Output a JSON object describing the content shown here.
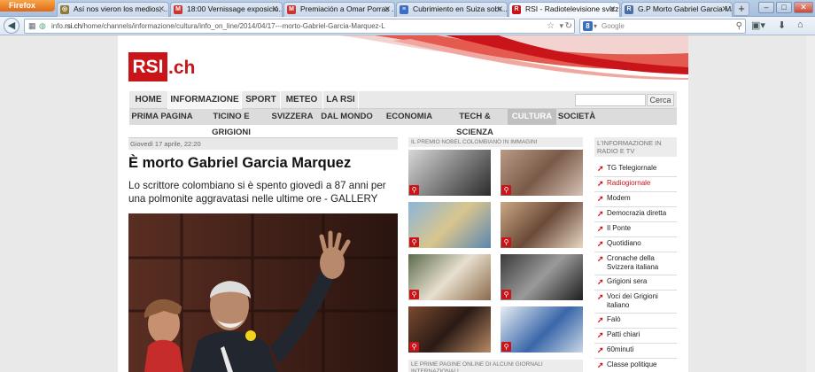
{
  "browser": {
    "app_button": "Firefox",
    "tabs": [
      {
        "label": "Así nos vieron los medios, ...",
        "favicon": "globe-icon",
        "fav_color": "#8a7a3a"
      },
      {
        "label": "18:00 Vernissage exposició...",
        "favicon": "gmail-icon",
        "fav_color": "#c33"
      },
      {
        "label": "Premiación a Omar Porras ...",
        "favicon": "gmail-icon",
        "fav_color": "#c33"
      },
      {
        "label": "Cubrimiento en Suiza sobr...",
        "favicon": "doc-icon",
        "fav_color": "#3a6fc4"
      },
      {
        "label": "RSI - Radiotelevisione svizz...",
        "favicon": "rsi-icon",
        "fav_color": "#c9141a"
      },
      {
        "label": "G.P Morto Gabriel Garcia Marq...",
        "favicon": "rsi-icon",
        "fav_color": "#4a6fa5"
      }
    ],
    "new_tab": "+",
    "url_prefix": "info.",
    "url_domain": "rsi.ch",
    "url_path": "/home/channels/informazione/cultura/info_on_line/2014/04/17---morto-Gabriel-Garcia-Marquez-L",
    "search_placeholder": "Google"
  },
  "site": {
    "logo_box": "RSI",
    "logo_suffix": ".ch",
    "main_nav": [
      "HOME",
      "INFORMAZIONE",
      "SPORT",
      "METEO",
      "LA RSI"
    ],
    "main_nav_active": "INFORMAZIONE",
    "search_button": "Cerca",
    "sub_nav": [
      "PRIMA PAGINA",
      "TICINO E GRIGIONI",
      "SVIZZERA",
      "DAL MONDO",
      "ECONOMIA",
      "TECH & SCIENZA",
      "CULTURA",
      "SOCIETÀ"
    ],
    "sub_nav_active": "CULTURA"
  },
  "article": {
    "date": "Giovedì 17 aprile, 22:20",
    "title": "È morto Gabriel Garcia Marquez",
    "subtitle": "Lo scrittore colombiano si è spento giovedì a 87 anni per una polmonite aggravatasi nelle ultime ore - GALLERY"
  },
  "gallery": {
    "heading": "IL PREMIO NOBEL COLOMBIANO IN IMMAGINI",
    "footer": "LE PRIME PAGINE ONLINE DI ALCUNI GIORNALI INTERNAZIONALI"
  },
  "sidebar": {
    "heading": "L'INFORMAZIONE IN RADIO E TV",
    "items": [
      {
        "label": "TG Telegiornale",
        "active": false
      },
      {
        "label": "Radiogiornale",
        "active": true
      },
      {
        "label": "Modem",
        "active": false
      },
      {
        "label": "Democrazia diretta",
        "active": false
      },
      {
        "label": "Il Ponte",
        "active": false
      },
      {
        "label": "Quotidiano",
        "active": false
      },
      {
        "label": "Cronache della Svizzera italiana",
        "active": false
      },
      {
        "label": "Grigioni sera",
        "active": false
      },
      {
        "label": "Voci dei Grigioni italiano",
        "active": false
      },
      {
        "label": "Falò",
        "active": false
      },
      {
        "label": "Patti chiari",
        "active": false
      },
      {
        "label": "60minuti",
        "active": false
      },
      {
        "label": "Classe politique",
        "active": false
      }
    ]
  },
  "colors": {
    "brand_red": "#c9141a",
    "nav_grey": "#e9e9e9"
  }
}
